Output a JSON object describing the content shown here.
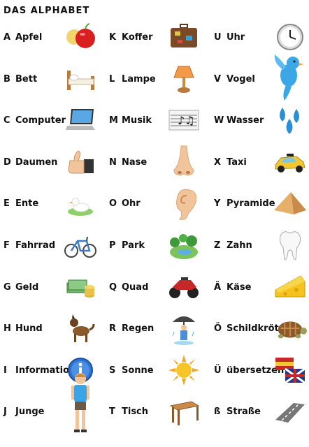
{
  "title": "DAS ALPHABET",
  "columns": [
    [
      {
        "letter": "A",
        "word": "Apfel",
        "icon": "apple-icon"
      },
      {
        "letter": "B",
        "word": "Bett",
        "icon": "bed-icon"
      },
      {
        "letter": "C",
        "word": "Computer",
        "icon": "laptop-icon"
      },
      {
        "letter": "D",
        "word": "Daumen",
        "icon": "thumbs-up-icon"
      },
      {
        "letter": "E",
        "word": "Ente",
        "icon": "duck-icon"
      },
      {
        "letter": "F",
        "word": "Fahrrad",
        "icon": "bicycle-icon"
      },
      {
        "letter": "G",
        "word": "Geld",
        "icon": "money-icon"
      },
      {
        "letter": "H",
        "word": "Hund",
        "icon": "dog-icon"
      },
      {
        "letter": "I",
        "word": "Information",
        "icon": "info-icon"
      },
      {
        "letter": "J",
        "word": "Junge",
        "icon": "boy-icon"
      }
    ],
    [
      {
        "letter": "K",
        "word": "Koffer",
        "icon": "suitcase-icon"
      },
      {
        "letter": "L",
        "word": "Lampe",
        "icon": "lamp-icon"
      },
      {
        "letter": "M",
        "word": "Musik",
        "icon": "music-sheet-icon"
      },
      {
        "letter": "N",
        "word": "Nase",
        "icon": "nose-icon"
      },
      {
        "letter": "O",
        "word": "Ohr",
        "icon": "ear-icon"
      },
      {
        "letter": "P",
        "word": "Park",
        "icon": "park-icon"
      },
      {
        "letter": "Q",
        "word": "Quad",
        "icon": "quad-bike-icon"
      },
      {
        "letter": "R",
        "word": "Regen",
        "icon": "rain-umbrella-icon"
      },
      {
        "letter": "S",
        "word": "Sonne",
        "icon": "sun-icon"
      },
      {
        "letter": "T",
        "word": "Tisch",
        "icon": "table-icon"
      }
    ],
    [
      {
        "letter": "U",
        "word": "Uhr",
        "icon": "clock-icon"
      },
      {
        "letter": "V",
        "word": "Vogel",
        "icon": "bird-icon"
      },
      {
        "letter": "W",
        "word": "Wasser",
        "icon": "water-drops-icon"
      },
      {
        "letter": "X",
        "word": "Taxi",
        "icon": "taxi-icon"
      },
      {
        "letter": "Y",
        "word": "Pyramide",
        "icon": "pyramid-icon"
      },
      {
        "letter": "Z",
        "word": "Zahn",
        "icon": "tooth-icon"
      },
      {
        "letter": "Ä",
        "word": "Käse",
        "icon": "cheese-icon"
      },
      {
        "letter": "Ö",
        "word": "Schildkröte",
        "icon": "turtle-icon"
      },
      {
        "letter": "Ü",
        "word": "übersetzen",
        "icon": "flags-icon"
      },
      {
        "letter": "ß",
        "word": "Straße",
        "icon": "road-icon"
      }
    ]
  ]
}
